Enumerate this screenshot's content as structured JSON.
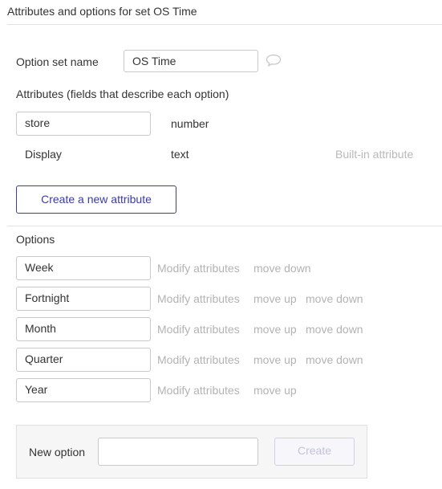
{
  "header": {
    "title": "Attributes and options for set OS Time"
  },
  "option_set": {
    "name_label": "Option set name",
    "name_value": "OS Time"
  },
  "attributes": {
    "heading": "Attributes (fields that describe each option)",
    "rows": [
      {
        "name": "store",
        "type": "number",
        "editable": true
      },
      {
        "name": "Display",
        "type": "text",
        "builtin_note": "Built-in attribute",
        "editable": false
      }
    ],
    "create_button": "Create a new attribute"
  },
  "options": {
    "heading": "Options",
    "modify_label": "Modify attributes",
    "move_up_label": "move up",
    "move_down_label": "move down",
    "items": [
      {
        "label": "Week"
      },
      {
        "label": "Fortnight"
      },
      {
        "label": "Month"
      },
      {
        "label": "Quarter"
      },
      {
        "label": "Year"
      }
    ]
  },
  "new_option": {
    "label": "New option",
    "value": "",
    "create_button": "Create"
  },
  "colors": {
    "accent": "#3b3aa6",
    "muted": "#b3b3b3",
    "border": "#c9c9c9"
  },
  "icons": {
    "comment": "comment-icon"
  }
}
